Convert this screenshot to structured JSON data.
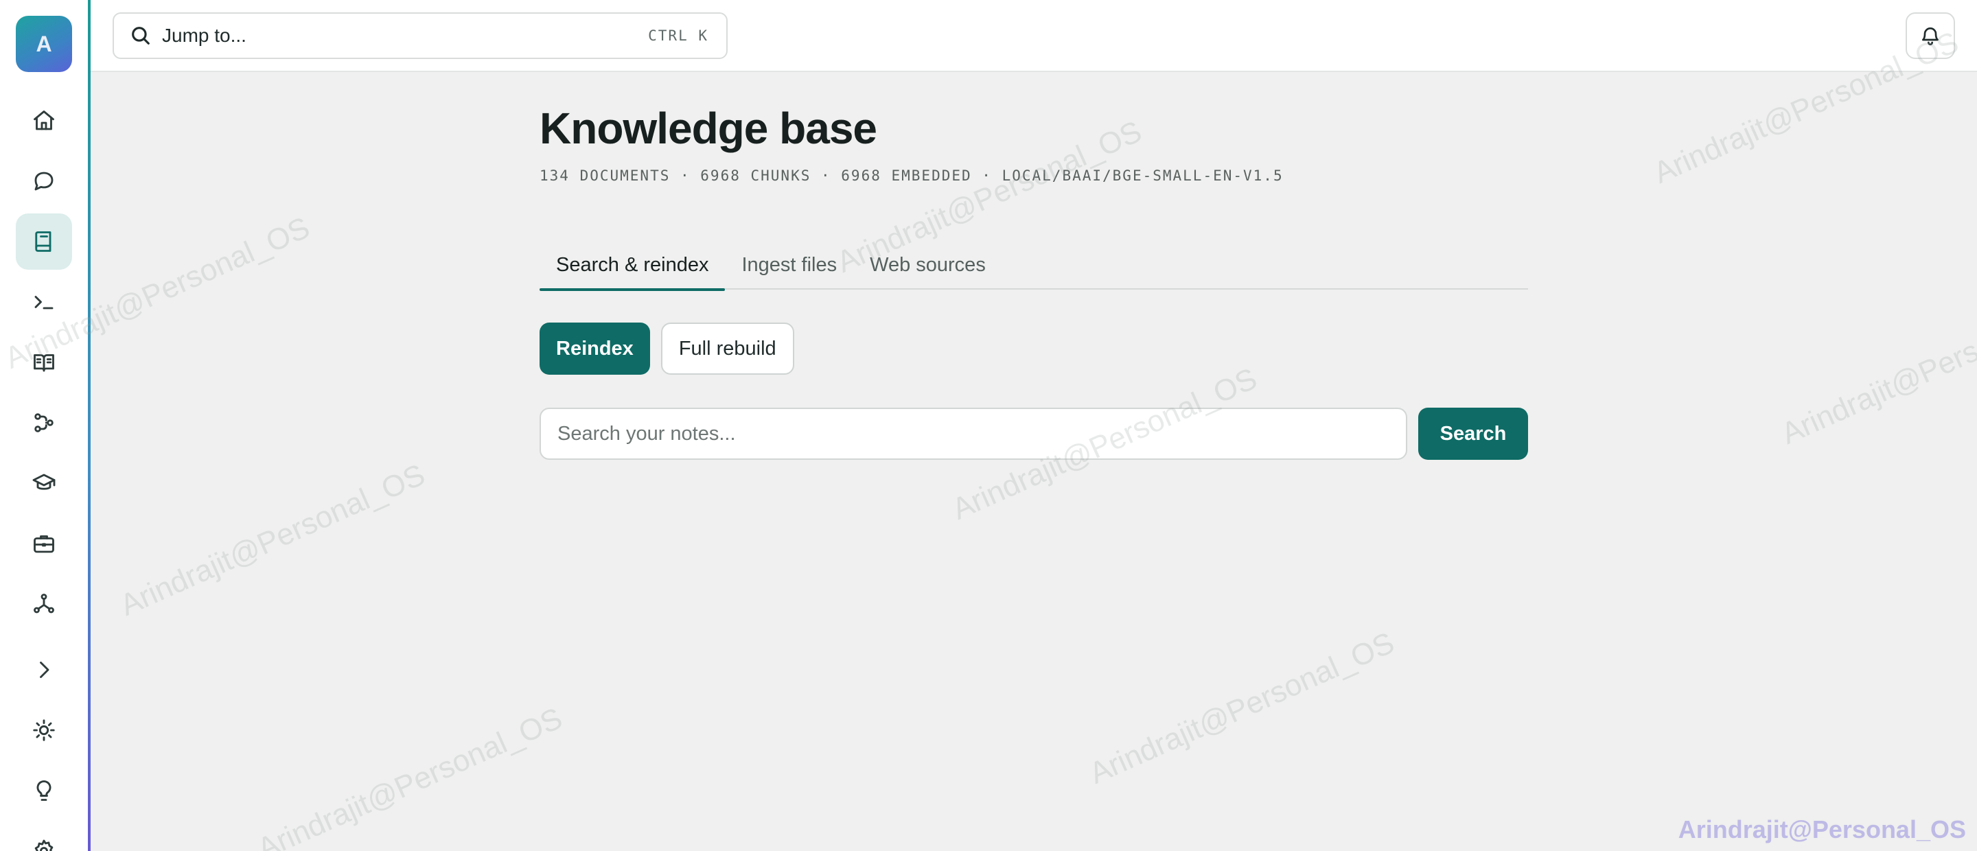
{
  "sidebar": {
    "avatar_letter": "A",
    "items": [
      {
        "name": "nav-home",
        "icon": "home-icon"
      },
      {
        "name": "nav-chat",
        "icon": "chat-bubble-icon"
      },
      {
        "name": "nav-knowledge-base",
        "icon": "book-icon",
        "active": true
      },
      {
        "name": "nav-terminal",
        "icon": "terminal-icon"
      },
      {
        "name": "nav-reader",
        "icon": "open-book-icon"
      },
      {
        "name": "nav-workflows",
        "icon": "workflow-icon"
      },
      {
        "name": "nav-learning",
        "icon": "graduation-cap-icon"
      },
      {
        "name": "nav-work",
        "icon": "briefcase-icon"
      },
      {
        "name": "nav-graph",
        "icon": "graph-nodes-icon"
      },
      {
        "name": "nav-expand",
        "icon": "chevron-right-icon"
      },
      {
        "name": "nav-theme",
        "icon": "sun-icon"
      },
      {
        "name": "nav-ideas",
        "icon": "lightbulb-icon"
      },
      {
        "name": "nav-settings",
        "icon": "gear-icon"
      }
    ]
  },
  "topbar": {
    "jump_label": "Jump to...",
    "shortcut": "CTRL K",
    "notifications_icon": "bell-icon"
  },
  "page": {
    "title": "Knowledge base",
    "meta": "134 DOCUMENTS · 6968 CHUNKS · 6968 EMBEDDED · LOCAL/BAAI/BGE-SMALL-EN-V1.5"
  },
  "tabs": [
    {
      "label": "Search & reindex",
      "active": true
    },
    {
      "label": "Ingest files"
    },
    {
      "label": "Web sources"
    }
  ],
  "actions": {
    "reindex_label": "Reindex",
    "full_rebuild_label": "Full rebuild"
  },
  "search": {
    "placeholder": "Search your notes...",
    "button_label": "Search"
  },
  "watermark": {
    "text": "Arindrajit@Personal_OS"
  },
  "colors": {
    "accent": "#0f6b66",
    "background": "#eff0ef",
    "active_nav_bg": "#dcedeb"
  }
}
